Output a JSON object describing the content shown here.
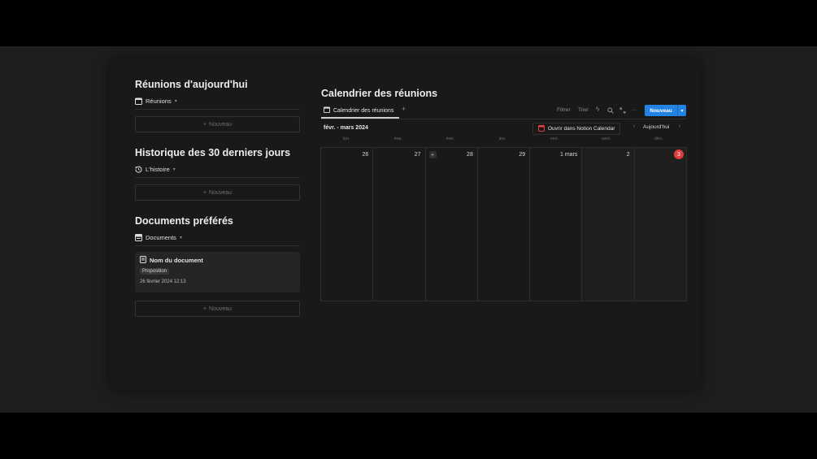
{
  "left": {
    "meetings_today": {
      "title": "Réunions d'aujourd'hui",
      "view_label": "Réunions",
      "new_label": "Nouveau"
    },
    "history": {
      "title": "Historique des 30 derniers jours",
      "view_label": "L'histoire",
      "new_label": "Nouveau"
    },
    "favorites": {
      "title": "Documents préférés",
      "view_label": "Documents",
      "card": {
        "title": "Nom du document",
        "tag": "Proposition",
        "date": "26 février 2024 12:13"
      },
      "new_label": "Nouveau"
    }
  },
  "calendar": {
    "title": "Calendrier des réunions",
    "tab_label": "Calendrier des réunions",
    "toolbar": {
      "filter": "Filtrer",
      "sort": "Trier",
      "new_button": "Nouveau"
    },
    "month_label": "févr. - mars 2024",
    "open_calendar": "Ouvrir dans Notion Calendar",
    "today": "Aujourd'hui",
    "weekdays": [
      "lun.",
      "mar.",
      "mer.",
      "jeu.",
      "ven.",
      "sam.",
      "dim."
    ],
    "days": [
      "26",
      "27",
      "28",
      "29",
      "1 mars",
      "2",
      "3"
    ],
    "accent": "#2383e2",
    "today_badge_color": "#e03e3e"
  }
}
